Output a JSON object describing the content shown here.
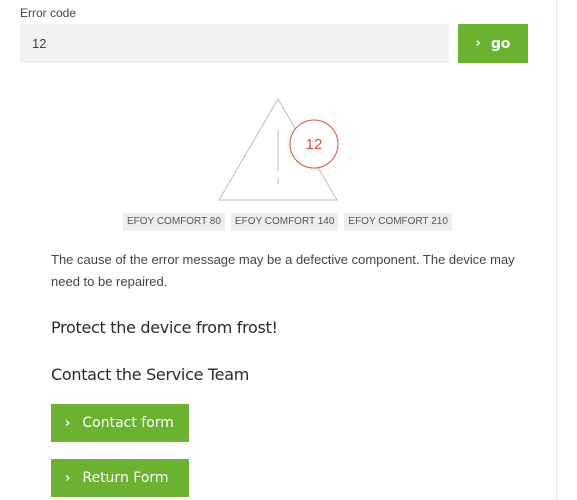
{
  "error_lookup": {
    "label": "Error code",
    "value": "12",
    "go_label": "go"
  },
  "warning": {
    "code": "12",
    "code_color": "#e04a3f"
  },
  "devices": [
    "EFOY COMFORT 80",
    "EFOY COMFORT 140",
    "EFOY COMFORT 210"
  ],
  "cause_text": "The cause of the error message may be a defective component. The device may need to be repaired.",
  "frost_heading": "Protect the device from frost!",
  "service_heading": "Contact the Service Team",
  "buttons": {
    "contact_form": "Contact form",
    "return_form": "Return Form"
  },
  "colors": {
    "accent": "#6ab22f",
    "input_bg": "#f2f2f2",
    "tag_bg": "#eeeeee"
  },
  "icons": {
    "button_prefix": "chevron-right-icon",
    "warning": "warning-triangle-icon"
  }
}
